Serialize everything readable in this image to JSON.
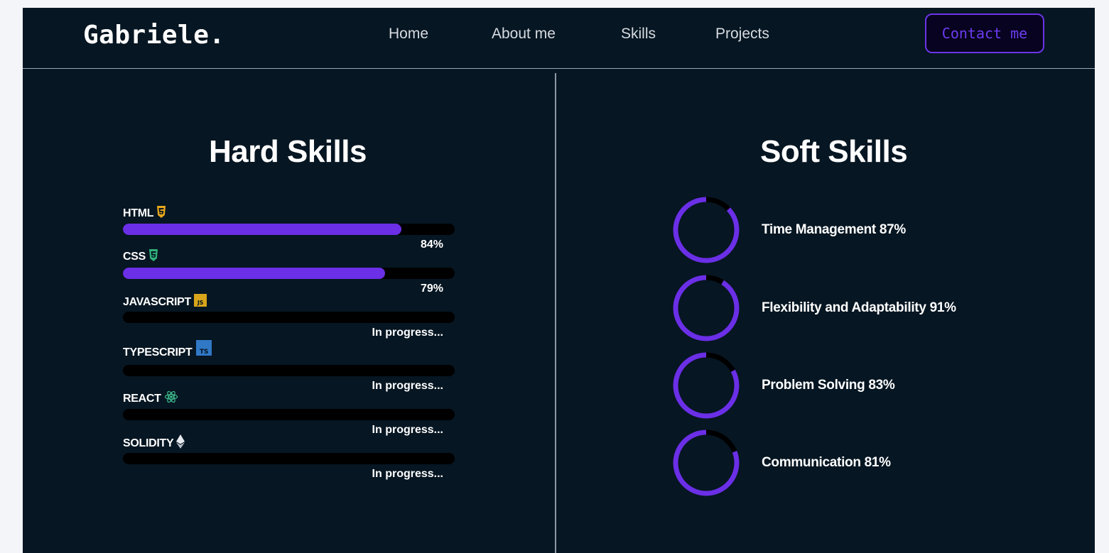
{
  "nav": {
    "brand": "Gabriele.",
    "links": [
      "Home",
      "About me",
      "Skills",
      "Projects"
    ],
    "contact_label": "Contact me",
    "accent": "#6a35e8"
  },
  "hard_skills": {
    "title": "Hard Skills",
    "items": [
      {
        "name": "HTML",
        "icon": "html5-icon",
        "progress": 84,
        "value_text": "84%"
      },
      {
        "name": "CSS",
        "icon": "css3-icon",
        "progress": 79,
        "value_text": "79%"
      },
      {
        "name": "JAVASCRIPT",
        "icon": "javascript-icon",
        "progress": 0,
        "value_text": "In progress..."
      },
      {
        "name": "TYPESCRIPT",
        "icon": "typescript-icon",
        "progress": 0,
        "value_text": "In progress..."
      },
      {
        "name": "REACT",
        "icon": "react-icon",
        "progress": 0,
        "value_text": "In progress..."
      },
      {
        "name": "SOLIDITY",
        "icon": "ethereum-icon",
        "progress": 0,
        "value_text": "In progress..."
      }
    ]
  },
  "soft_skills": {
    "title": "Soft Skills",
    "items": [
      {
        "label": "Time Management 87%",
        "progress": 87
      },
      {
        "label": "Flexibility and Adaptability 91%",
        "progress": 91
      },
      {
        "label": "Problem Solving 83%",
        "progress": 83
      },
      {
        "label": "Communication 81%",
        "progress": 81
      }
    ]
  },
  "colors": {
    "background": "#061622",
    "bar_fill": "#6a2fe6",
    "bar_track": "#000000",
    "html_icon": "#e8a71c",
    "css_icon": "#2fb07a",
    "js_icon": "#d9a51a",
    "ts_icon": "#3178c6",
    "react_icon": "#3fbf8f"
  }
}
